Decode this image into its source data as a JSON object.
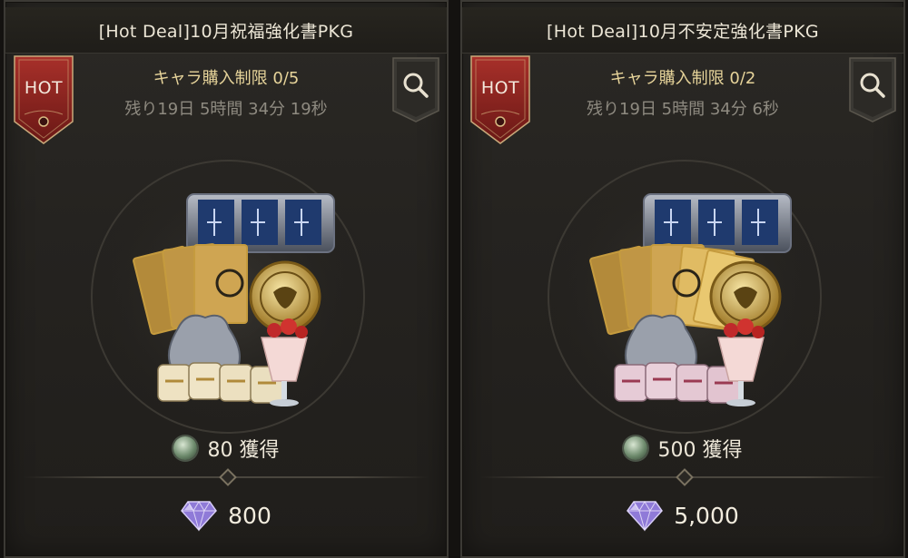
{
  "cards": [
    {
      "title": "[Hot Deal]10月祝福強化書PKG",
      "badge": "HOT",
      "limit": "キャラ購入制限 0/5",
      "time_left": "残り19日 5時間 34分 19秒",
      "reward": "80 獲得",
      "price": "800",
      "icons": {
        "badge": "hot-badge-icon",
        "search": "search-icon",
        "reward": "currency-coin-icon",
        "price": "diamond-icon"
      }
    },
    {
      "title": "[Hot Deal]10月不安定強化書PKG",
      "badge": "HOT",
      "limit": "キャラ購入制限 0/2",
      "time_left": "残り19日 5時間 34分 6秒",
      "reward": "500 獲得",
      "price": "5,000",
      "icons": {
        "badge": "hot-badge-icon",
        "search": "search-icon",
        "reward": "currency-coin-icon",
        "price": "diamond-icon"
      }
    }
  ],
  "colors": {
    "card_bg": "#252320",
    "title_text": "#ece6d6",
    "limit_text": "#e7d49a",
    "time_text": "#8e8a80",
    "badge_red": "#8e2622",
    "gem_purple": "#9d7fe0"
  }
}
